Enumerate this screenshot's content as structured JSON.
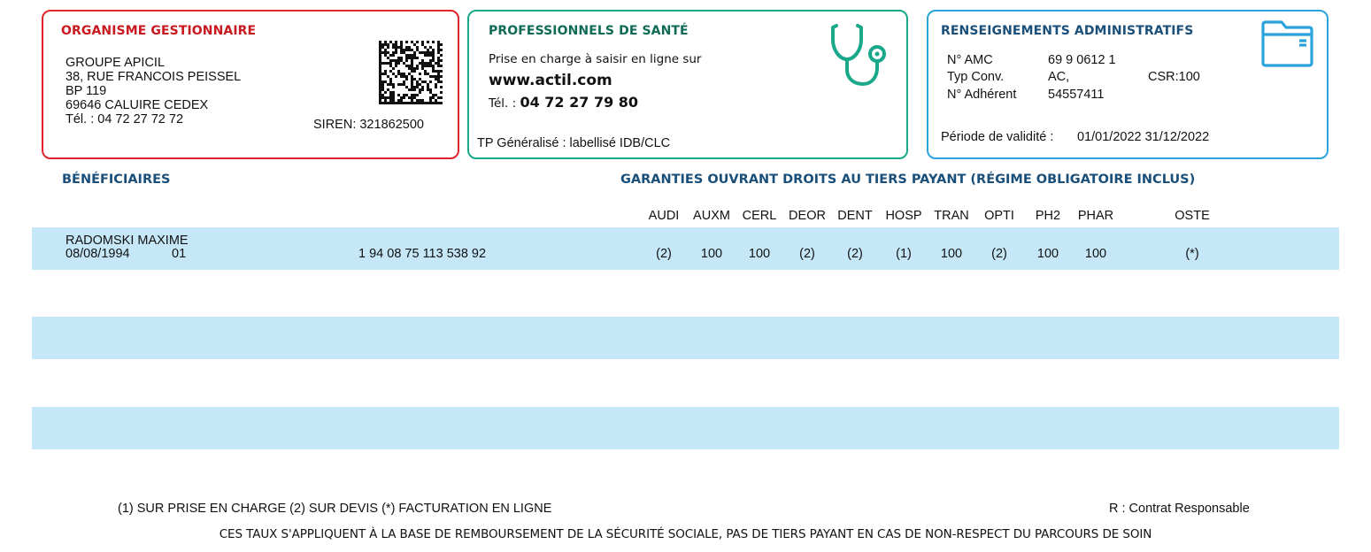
{
  "organisme": {
    "title": "ORGANISME GESTIONNAIRE",
    "lines": [
      "GROUPE APICIL",
      "38, RUE FRANCOIS PEISSEL",
      "BP 119",
      "69646 CALUIRE CEDEX",
      "Tél. : 04 72 27 72 72"
    ],
    "siren": "SIREN: 321862500",
    "accent": "#e0262c"
  },
  "professionnels": {
    "title": "PROFESSIONNELS DE SANTÉ",
    "prise": "Prise en charge à saisir en ligne sur",
    "url": "www.actil.com",
    "tel_label": "Tél. :",
    "tel_value": "04 72 27 79 80",
    "tp": "TP Généralisé : labellisé IDB/CLC",
    "icon": "stethoscope-icon",
    "accent": "#1aa88a"
  },
  "administratif": {
    "title": "RENSEIGNEMENTS ADMINISTRATIFS",
    "amc_label": "N° AMC",
    "amc_value": "69 9 0612 1",
    "conv_label": "Typ Conv.",
    "conv_value": "AC,",
    "csr": "CSR:100",
    "adherent_label": "N° Adhérent",
    "adherent_value": "54557411",
    "periode_label": "Période de validité :",
    "periode_value": "01/01/2022  31/12/2022",
    "icon": "folder-icon",
    "accent": "#2ba3dc"
  },
  "beneficiaires_title": "BÉNÉFICIAIRES",
  "garanties_title": "GARANTIES OUVRANT DROITS AU TIERS PAYANT (RÉGIME OBLIGATOIRE INCLUS)",
  "columns": [
    "AUDI",
    "AUXM",
    "CERL",
    "DEOR",
    "DENT",
    "HOSP",
    "TRAN",
    "OPTI",
    "PH2",
    "PHAR",
    "OSTE"
  ],
  "beneficiary": {
    "name": "RADOMSKI MAXIME",
    "birth": "08/08/1994",
    "rang": "01",
    "nir": "1 94 08 75 113 538 92",
    "values": [
      "(2)",
      "100",
      "100",
      "(2)",
      "(2)",
      "(1)",
      "100",
      "(2)",
      "100",
      "100",
      "(*)"
    ]
  },
  "footer": {
    "legend": "(1) SUR PRISE EN CHARGE (2) SUR DEVIS (*) FACTURATION EN LIGNE",
    "responsable": "R : Contrat Responsable",
    "note": "CES TAUX S'APPLIQUENT À LA BASE DE REMBOURSEMENT DE LA SÉCURITÉ SOCIALE, PAS DE TIERS PAYANT EN CAS DE NON-RESPECT DU PARCOURS DE SOIN"
  },
  "colors": {
    "row_band": "#c6e7f8",
    "section_title": "#1a4f7a"
  }
}
